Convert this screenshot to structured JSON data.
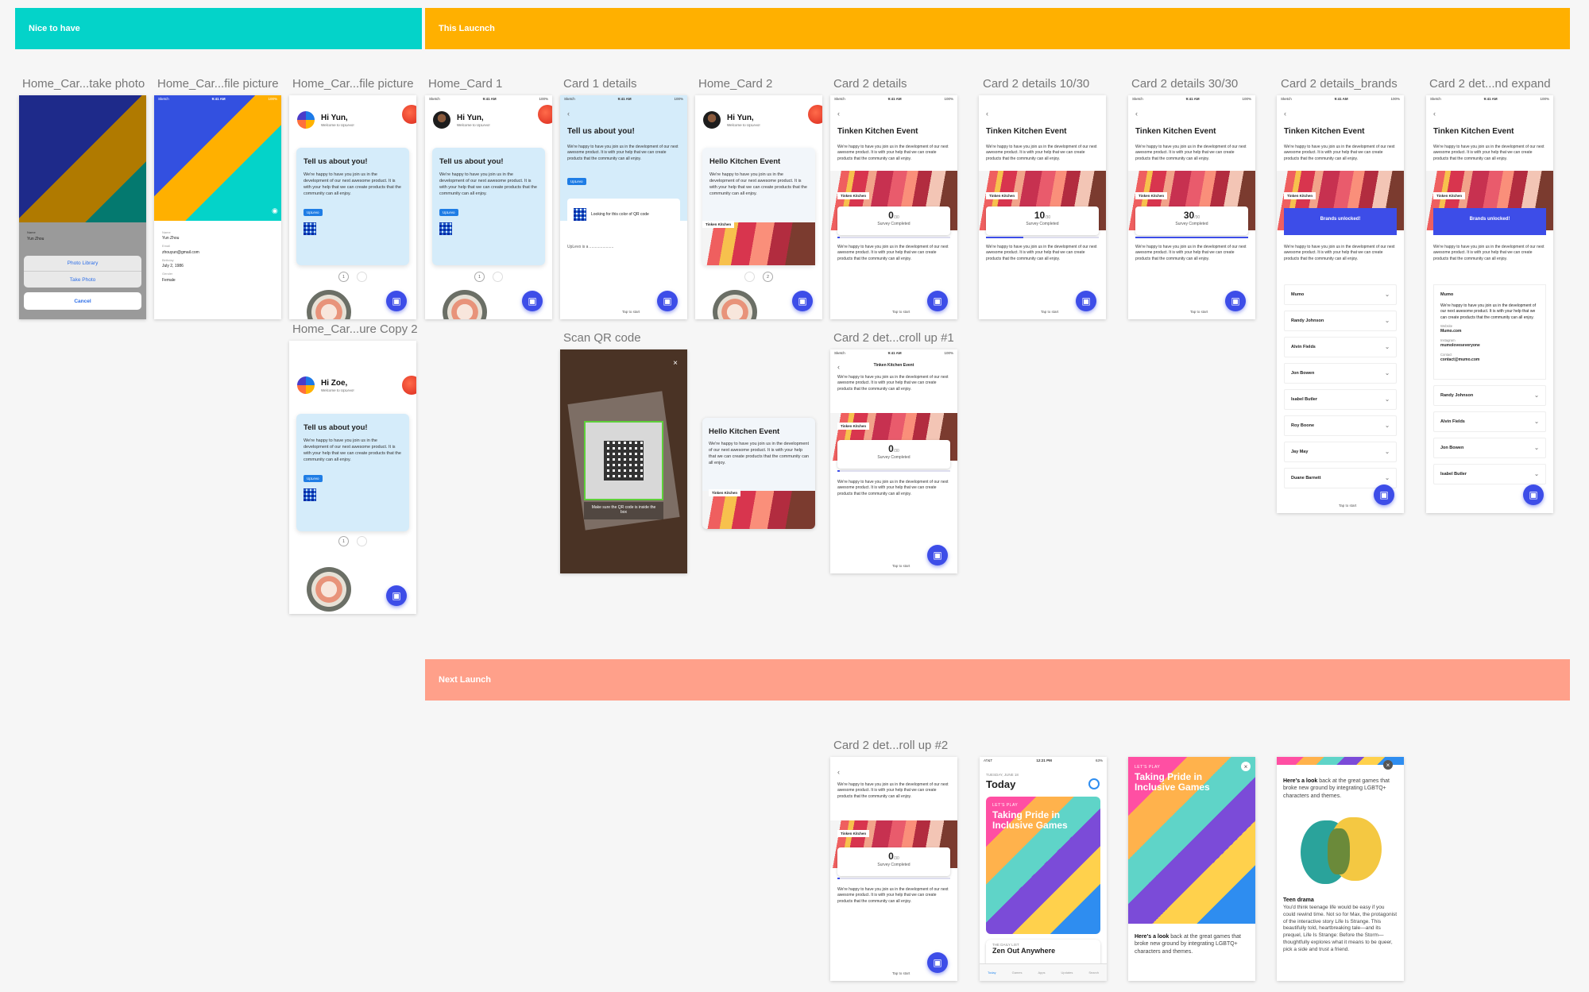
{
  "banners": {
    "nice": "Nice to have",
    "launch": "This Laucnch",
    "next": "Next Launch"
  },
  "artboards": {
    "a1": "Home_Car...take photo",
    "a2": "Home_Car...file picture",
    "a3": "Home_Car...file picture",
    "a4": "Home_Card 1",
    "a5": "Card 1 details",
    "a6": "Home_Card 2",
    "a7": "Card 2 details",
    "a8": "Card 2 details 10/30",
    "a9": "Card 2 details 30/30",
    "a10": "Card 2 details_brands",
    "a11": "Card 2 det...nd expand",
    "a12": "Home_Car...ure Copy 2",
    "a13": "Scan QR code",
    "a14": "Card 2 det...croll up #1",
    "a15": "Card 2 det...roll up #2"
  },
  "status": {
    "carrier": "Sketch",
    "time": "9:41 AM",
    "battery": "100%",
    "carrier2": "AT&T",
    "time2": "12:21 PM",
    "battery2": "63%"
  },
  "greeting": {
    "yun": "Hi Yun,",
    "zoe": "Hi Zoe,",
    "sub": "Welcome to UpLevo!"
  },
  "intro": {
    "title": "Tell us about you!",
    "body": "We're happy to have you join us in the development of our next awesome product. It is with your help that we can create products that the community can all enjoy.",
    "tag": "UpLevo"
  },
  "kitchen": {
    "hello": "Hello Kitchen Event",
    "event": "Tinken Kitchen Event",
    "label": "Tinken Kitchen",
    "survey": "Survey Completed",
    "of": "/30",
    "v0": "0",
    "v10": "10",
    "v30": "30",
    "brands_unlocked": "Brands unlocked!"
  },
  "pager": {
    "p1": "1",
    "p2": "2"
  },
  "details1": {
    "looking": "Looking for this color of QR code",
    "uplevo": "UpLevo is a ......................",
    "tap": "Tap to start"
  },
  "qr": {
    "hint": "Make sure the QR code is inside the box",
    "close": "×"
  },
  "photo": {
    "library": "Photo Library",
    "take": "Take Photo",
    "cancel": "Cancel",
    "name_label": "Name",
    "name": "Yun Zhou",
    "email_label": "Email",
    "email": "zhouyun@gmail.com",
    "bday_label": "Birthday",
    "bday": "July 2, 1986",
    "gender_label": "Gender",
    "gender": "Female"
  },
  "brands": [
    "Mumo",
    "Randy Johnson",
    "Alvin Fields",
    "Jon Bowen",
    "Isabel Butler",
    "Roy Boone",
    "Jay May",
    "Duane Barnett"
  ],
  "brands_expand": [
    "Randy Johnson",
    "Alvin Fields",
    "Jon Bowen",
    "Isabel Butler"
  ],
  "mumo": {
    "name": "Mumo",
    "website_label": "Website",
    "website": "Mumo.com",
    "insta_label": "Instagram",
    "insta": "mumoloveseveryone",
    "contact_label": "Contact",
    "contact": "contact@mumo.com"
  },
  "appstore": {
    "date": "TUESDAY, JUNE 18",
    "today": "Today",
    "kicker": "LET'S PLAY",
    "title": "Taking Pride in Inclusive Games",
    "daily": "THE DAILY LIST",
    "zone": "Zen Out Anywhere",
    "lead": "Here's a look",
    "lead_rest": "back at the great games that broke new ground by integrating LGBTQ+ characters and themes.",
    "teen": "Teen drama",
    "teen_body": "You'd think teenage life would be easy if you could rewind time. Not so for Max, the protagonist of the interactive story Life Is Strange. This beautifully told, heartbreaking tale—and its prequel, Life Is Strange: Before the Storm—thoughtfully explores what it means to be queer, pick a side and trust a friend.",
    "tabs": [
      "Today",
      "Games",
      "Apps",
      "Updates",
      "Search"
    ]
  },
  "colors": {
    "teal": "#04d3c9",
    "orange": "#ffb000",
    "salmon": "#ffa08a",
    "fab": "#3d4de8"
  }
}
